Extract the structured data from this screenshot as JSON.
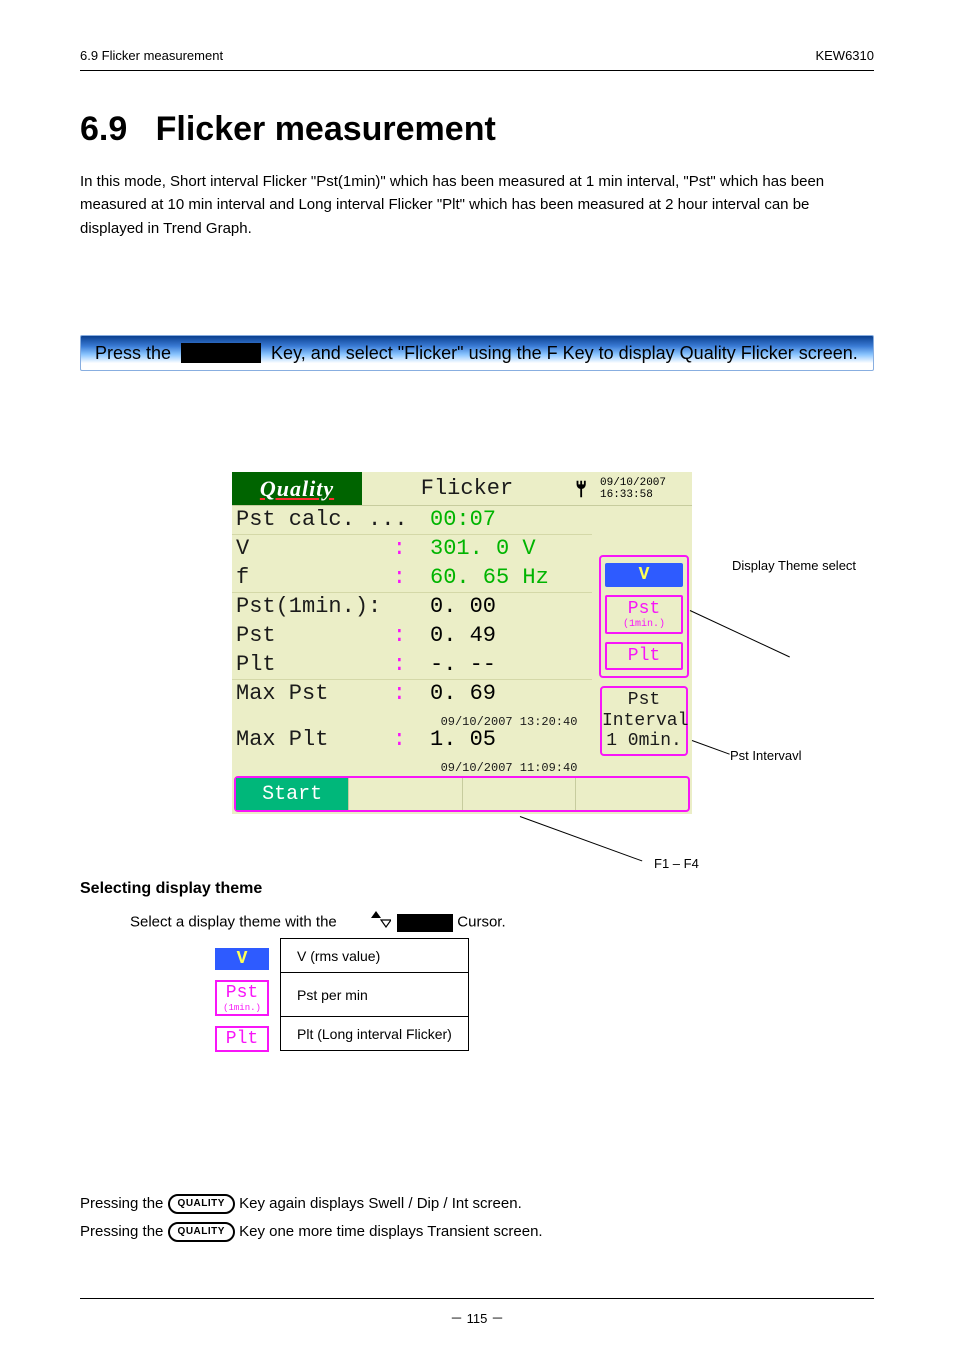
{
  "header": {
    "left": "6.9 Flicker measurement",
    "right": "KEW6310"
  },
  "section": {
    "number": "6.9",
    "title": "Flicker measurement",
    "intro": "In this mode, Short interval Flicker \"Pst(1min)\" which has been measured at 1 min interval, \"Pst\" which has been measured at 10 min interval and Long interval Flicker \"Plt\" which has been measured at 2 hour interval can be displayed in Trend Graph.",
    "banner_pre": "Press the",
    "banner_post": "Key, and select \"Flicker\" using the F Key to display Quality Flicker screen."
  },
  "device": {
    "title_brand": "Quality",
    "title_mode": "Flicker",
    "title_date": "09/10/2007",
    "title_time": "16:33:58",
    "rows": {
      "pstcalc": {
        "label": "Pst calc. ...",
        "value": "00:07"
      },
      "v": {
        "label": "V",
        "value": "301. 0 V"
      },
      "f": {
        "label": "f",
        "value": "60. 65 Hz"
      },
      "pst1": {
        "label": "Pst(1min.):",
        "value": "0. 00"
      },
      "pst": {
        "label": "Pst",
        "value": "0. 49"
      },
      "plt": {
        "label": "Plt",
        "value": "-. --"
      },
      "maxpst": {
        "label": "Max Pst",
        "value": "0. 69",
        "ts": "09/10/2007 13:20:40"
      },
      "maxplt": {
        "label": "Max Plt",
        "value": "1. 05",
        "ts": "09/10/2007 11:09:40"
      }
    },
    "side": {
      "v": "V",
      "pst1_top": "Pst",
      "pst1_sub": "(1min.)",
      "plt": "Plt",
      "interval_top": "Pst",
      "interval_mid": "Interval",
      "interval_bot": "1 0min."
    },
    "footer": {
      "start": "Start"
    }
  },
  "callouts": {
    "theme": "Display Theme select",
    "interval": "Pst Intervavl",
    "fkey": "F1 – F4"
  },
  "sub": {
    "para": "Selecting display theme",
    "lead": "Select a display theme with the ",
    "lead_tail": " Cursor.",
    "tbl": {
      "r1c1": "V (rms value)",
      "r2c1": "Pst per min",
      "r3c1": "Plt (Long interval Flicker)"
    }
  },
  "footnote": {
    "line1a": "Pressing the ",
    "line1b": " Key again displays Swell / Dip / Int screen.",
    "line2a": "Pressing the ",
    "line2b": " Key one more time displays Transient screen."
  },
  "footer": {
    "page": "－ 115 －"
  }
}
